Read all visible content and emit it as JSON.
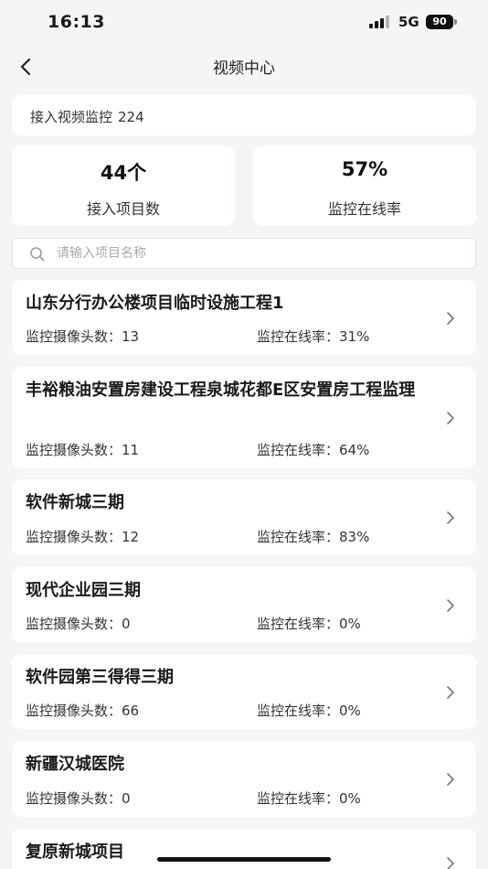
{
  "status_bar": {
    "time": "16:13",
    "network": "5G",
    "battery": "90"
  },
  "nav": {
    "title": "视频中心"
  },
  "summary": {
    "label": "接入视频监控",
    "count": "224"
  },
  "stats": [
    {
      "value": "44个",
      "label": "接入项目数"
    },
    {
      "value": "57%",
      "label": "监控在线率"
    }
  ],
  "search": {
    "placeholder": "请输入项目名称"
  },
  "labels": {
    "camera_count": "监控摄像头数：",
    "online_rate": "监控在线率："
  },
  "projects": [
    {
      "name": "山东分行办公楼项目临时设施工程1",
      "cameras": "13",
      "rate": "31%"
    },
    {
      "name": "丰裕粮油安置房建设工程泉城花都E区安置房工程监理",
      "cameras": "11",
      "rate": "64%"
    },
    {
      "name": "软件新城三期",
      "cameras": "12",
      "rate": "83%"
    },
    {
      "name": "现代企业园三期",
      "cameras": "0",
      "rate": "0%"
    },
    {
      "name": "软件园第三得得三期",
      "cameras": "66",
      "rate": "0%"
    },
    {
      "name": "新疆汉城医院",
      "cameras": "0",
      "rate": "0%"
    },
    {
      "name": "复原新城项目"
    }
  ]
}
